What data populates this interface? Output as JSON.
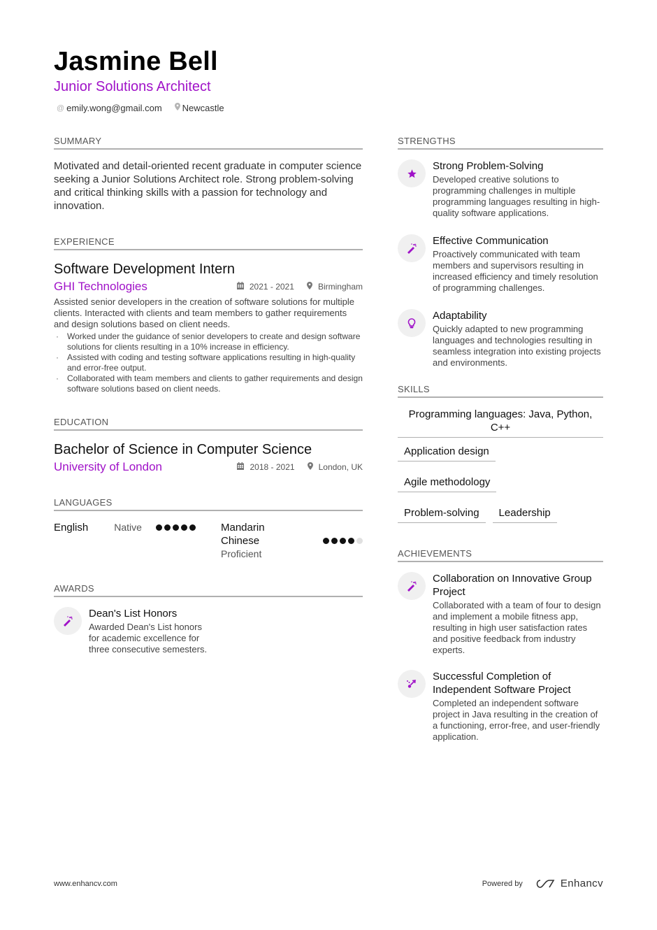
{
  "header": {
    "name": "Jasmine Bell",
    "title": "Junior Solutions Architect",
    "email": "emily.wong@gmail.com",
    "location": "Newcastle",
    "email_icon": "at-icon",
    "location_icon": "map-pin-icon"
  },
  "summary": {
    "heading": "SUMMARY",
    "text": "Motivated and detail-oriented recent graduate in computer science seeking a Junior Solutions Architect role. Strong problem-solving and critical thinking skills with a passion for technology and innovation."
  },
  "experience": {
    "heading": "EXPERIENCE",
    "jobs": [
      {
        "title": "Software Development Intern",
        "company": "GHI Technologies",
        "dates": "2021 - 2021",
        "location": "Birmingham",
        "description": "Assisted senior developers in the creation of software solutions for multiple clients. Interacted with clients and team members to gather requirements and design solutions based on client needs.",
        "bullets": [
          "Worked under the guidance of senior developers to create and design software solutions for clients resulting in a 10% increase in efficiency.",
          "Assisted with coding and testing software applications resulting in high-quality and error-free output.",
          "Collaborated with team members and clients to gather requirements and design software solutions based on client needs."
        ]
      }
    ]
  },
  "education": {
    "heading": "EDUCATION",
    "items": [
      {
        "degree": "Bachelor of Science in Computer Science",
        "school": "University of London",
        "dates": "2018 - 2021",
        "location": "London, UK"
      }
    ]
  },
  "languages": {
    "heading": "LANGUAGES",
    "items": [
      {
        "name": "English",
        "level": "Native",
        "rating": 5,
        "max": 5
      },
      {
        "name": "Mandarin Chinese",
        "level": "Proficient",
        "rating": 4,
        "max": 5
      }
    ]
  },
  "awards": {
    "heading": "AWARDS",
    "items": [
      {
        "icon": "magic-wand-icon",
        "title": "Dean's List Honors",
        "description": "Awarded Dean's List honors for academic excellence for three consecutive semesters."
      }
    ]
  },
  "strengths": {
    "heading": "STRENGTHS",
    "items": [
      {
        "icon": "star-icon",
        "title": "Strong Problem-Solving",
        "description": "Developed creative solutions to programming challenges in multiple programming languages resulting in high-quality software applications."
      },
      {
        "icon": "magic-wand-icon",
        "title": "Effective Communication",
        "description": "Proactively communicated with team members and supervisors resulting in increased efficiency and timely resolution of programming challenges."
      },
      {
        "icon": "lightbulb-icon",
        "title": "Adaptability",
        "description": "Quickly adapted to new programming languages and technologies resulting in seamless integration into existing projects and environments."
      }
    ]
  },
  "skills": {
    "heading": "SKILLS",
    "items": [
      "Programming languages: Java, Python, C++",
      "Application design",
      "Agile methodology",
      "Problem-solving",
      "Leadership"
    ]
  },
  "achievements": {
    "heading": "ACHIEVEMENTS",
    "items": [
      {
        "icon": "magic-wand-icon",
        "title": "Collaboration on Innovative Group Project",
        "description": "Collaborated with a team of four to design and implement a mobile fitness app, resulting in high user satisfaction rates and positive feedback from industry experts."
      },
      {
        "icon": "route-icon",
        "title": "Successful Completion of Independent Software Project",
        "description": "Completed an independent software project in Java resulting in the creation of a functioning, error-free, and user-friendly application."
      }
    ]
  },
  "footer": {
    "website": "www.enhancv.com",
    "powered_by": "Powered by",
    "brand": "Enhancv"
  },
  "colors": {
    "accent": "#a012c8",
    "icon_bg": "#f0f0f0",
    "rule": "#b0b0b0"
  }
}
